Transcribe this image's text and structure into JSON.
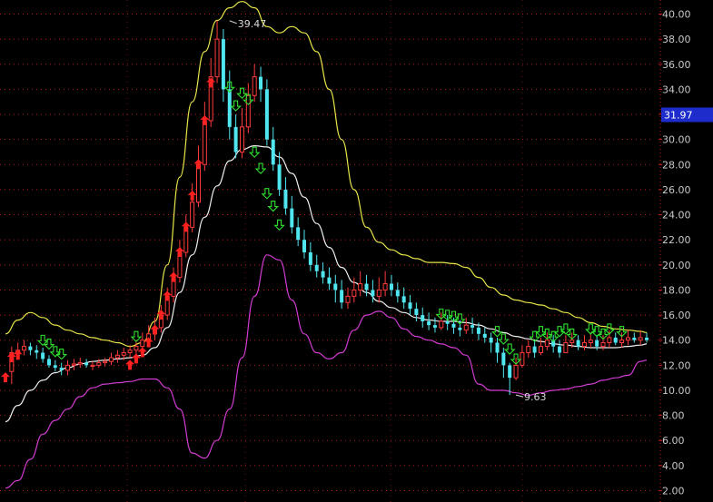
{
  "chart_data": {
    "type": "line",
    "ylim": [
      2,
      41
    ],
    "y_ticks": [
      "2.00",
      "4.00",
      "6.00",
      "8.00",
      "10.00",
      "12.00",
      "14.00",
      "16.00",
      "18.00",
      "20.00",
      "22.00",
      "24.00",
      "26.00",
      "28.00",
      "30.00",
      "32.00",
      "34.00",
      "36.00",
      "38.00",
      "40.00"
    ],
    "current_price_label": "31.97",
    "current_price": 31.97,
    "annotations": [
      {
        "text": "39.47",
        "x": 36,
        "y": 39.47
      },
      {
        "text": "9.63",
        "x": 82,
        "y": 9.63
      }
    ],
    "colors": {
      "upper_band": "#e6e64a",
      "middle_band": "#f0f0f0",
      "lower_band": "#d23cd2",
      "candle_up": "#ff3c3c",
      "candle_down": "#50e6f0",
      "buy_arrow": "#ff2020",
      "sell_arrow": "#30e030",
      "grid": "#c81e1e",
      "price_tag_bg": "#1e2ccc"
    },
    "x_range": [
      0,
      103
    ],
    "series": [
      {
        "key": "upper",
        "x": [
          0,
          2,
          4,
          6,
          8,
          10,
          12,
          14,
          16,
          18,
          20,
          22,
          24,
          26,
          28,
          30,
          32,
          34,
          36,
          38,
          40,
          42,
          44,
          46,
          48,
          50,
          52,
          54,
          56,
          58,
          60,
          62,
          64,
          66,
          68,
          70,
          72,
          74,
          76,
          78,
          80,
          82,
          84,
          86,
          88,
          90,
          92,
          94,
          96,
          98,
          100,
          102,
          103
        ],
        "values": [
          14.5,
          15.6,
          16.2,
          15.8,
          15.2,
          14.8,
          14.5,
          14.2,
          14.0,
          13.8,
          13.5,
          13.8,
          15.5,
          20,
          27,
          33,
          37,
          39.5,
          40.5,
          41,
          40.5,
          39,
          38.5,
          39,
          38.5,
          37,
          34,
          30,
          26,
          23,
          21.8,
          21.2,
          20.8,
          20.5,
          20.2,
          20.2,
          20.1,
          19.8,
          19.0,
          18.2,
          17.6,
          17.2,
          17.0,
          16.8,
          16.5,
          16.2,
          15.8,
          15.4,
          15.1,
          14.9,
          14.8,
          14.7,
          14.6
        ]
      },
      {
        "key": "middle",
        "x": [
          0,
          2,
          4,
          6,
          8,
          10,
          12,
          14,
          16,
          18,
          20,
          22,
          24,
          26,
          28,
          30,
          32,
          34,
          36,
          38,
          40,
          42,
          44,
          46,
          48,
          50,
          52,
          54,
          56,
          58,
          60,
          62,
          64,
          66,
          68,
          70,
          72,
          74,
          76,
          78,
          80,
          82,
          84,
          86,
          88,
          90,
          92,
          94,
          96,
          98,
          100,
          102,
          103
        ],
        "values": [
          7.5,
          8.8,
          10,
          10.8,
          11.4,
          11.8,
          12.1,
          12.3,
          12.4,
          12.5,
          12.6,
          12.8,
          13.4,
          15,
          17.8,
          20.8,
          23.8,
          26.3,
          28.3,
          29.2,
          29.5,
          29.4,
          28.6,
          27.3,
          25.4,
          23.3,
          21.4,
          19.8,
          18.6,
          17.8,
          17.1,
          16.6,
          16.2,
          15.8,
          15.6,
          15.5,
          15.5,
          15.4,
          15.2,
          14.9,
          14.6,
          14.3,
          14.1,
          13.9,
          13.7,
          13.6,
          13.5,
          13.4,
          13.4,
          13.4,
          13.5,
          13.6,
          13.7
        ]
      },
      {
        "key": "lower",
        "x": [
          0,
          2,
          4,
          6,
          8,
          10,
          12,
          14,
          16,
          18,
          20,
          22,
          24,
          26,
          28,
          30,
          32,
          34,
          36,
          38,
          40,
          42,
          44,
          46,
          48,
          50,
          52,
          54,
          56,
          58,
          60,
          62,
          64,
          66,
          68,
          70,
          72,
          74,
          76,
          78,
          80,
          82,
          84,
          86,
          88,
          90,
          92,
          94,
          96,
          98,
          100,
          102,
          103
        ],
        "values": [
          2.2,
          2.8,
          4.5,
          6.5,
          7.6,
          8.5,
          9.5,
          10.2,
          10.5,
          10.6,
          10.7,
          10.9,
          10.9,
          10.2,
          8.5,
          5.0,
          4.6,
          6.0,
          8.5,
          12.6,
          17.5,
          20.8,
          20.4,
          17.2,
          14.5,
          13.0,
          12.5,
          13.0,
          14.8,
          16.0,
          16.3,
          15.8,
          14.9,
          14.3,
          14.0,
          13.7,
          13.4,
          12.8,
          10.5,
          10.0,
          10.0,
          9.8,
          9.6,
          9.8,
          10.0,
          10.1,
          10.3,
          10.5,
          10.8,
          11.0,
          11.2,
          12.3,
          12.4
        ]
      },
      {
        "key": "candles",
        "x": [
          1,
          2,
          3,
          4,
          5,
          6,
          7,
          8,
          9,
          10,
          11,
          12,
          13,
          14,
          15,
          16,
          17,
          18,
          19,
          20,
          21,
          22,
          23,
          24,
          25,
          26,
          27,
          28,
          29,
          30,
          31,
          32,
          33,
          34,
          35,
          36,
          37,
          38,
          39,
          40,
          41,
          42,
          43,
          44,
          45,
          46,
          47,
          48,
          49,
          50,
          51,
          52,
          53,
          54,
          55,
          56,
          57,
          58,
          59,
          60,
          61,
          62,
          63,
          64,
          65,
          66,
          67,
          68,
          69,
          70,
          71,
          72,
          73,
          74,
          75,
          76,
          77,
          78,
          79,
          80,
          81,
          82,
          83,
          84,
          85,
          86,
          87,
          88,
          89,
          90,
          91,
          92,
          93,
          94,
          95,
          96,
          97,
          98,
          99,
          100,
          101,
          102,
          103
        ],
        "open": [
          11.5,
          13.0,
          13.2,
          13.5,
          13.2,
          13.0,
          12.5,
          12.0,
          11.8,
          11.6,
          12.0,
          12.1,
          12.2,
          12.0,
          12.0,
          12.2,
          12.3,
          12.6,
          12.8,
          13.0,
          13.2,
          13.5,
          14.0,
          14.5,
          15.0,
          16.0,
          17.5,
          19.0,
          21.0,
          23.0,
          25.0,
          28.0,
          31.5,
          35.0,
          38.0,
          34.0,
          31.0,
          29.0,
          31.0,
          33.5,
          35.0,
          34.0,
          30.0,
          28.0,
          26.0,
          24.5,
          23.0,
          22.0,
          21.0,
          20.0,
          19.5,
          19.0,
          18.5,
          18.0,
          17.0,
          17.5,
          18.0,
          18.5,
          18.0,
          17.5,
          18.0,
          18.5,
          18.0,
          17.5,
          17.0,
          16.5,
          16.0,
          15.5,
          15.2,
          15.0,
          15.5,
          15.3,
          15.0,
          14.8,
          15.2,
          15.0,
          14.5,
          14.2,
          13.8,
          13.0,
          12.0,
          11.0,
          12.0,
          13.0,
          13.5,
          13.0,
          13.5,
          14.0,
          13.5,
          13.0,
          13.8,
          14.0,
          13.5,
          13.8,
          14.0,
          13.5,
          13.8,
          14.2,
          13.8,
          14.0,
          14.2,
          14.0,
          14.2
        ],
        "close": [
          13.0,
          13.2,
          13.5,
          13.2,
          13.0,
          12.5,
          12.0,
          11.8,
          11.6,
          12.0,
          12.1,
          12.2,
          12.0,
          12.0,
          12.2,
          12.3,
          12.6,
          12.8,
          13.0,
          13.2,
          13.5,
          14.0,
          14.5,
          15.0,
          16.0,
          17.5,
          19.0,
          21.0,
          23.0,
          25.0,
          28.0,
          31.5,
          35.0,
          38.0,
          34.0,
          31.0,
          29.0,
          31.0,
          33.5,
          35.0,
          34.0,
          30.0,
          28.0,
          26.0,
          24.5,
          23.0,
          22.0,
          21.0,
          20.0,
          19.5,
          19.0,
          18.5,
          18.0,
          17.0,
          17.5,
          18.0,
          18.5,
          18.0,
          17.5,
          18.0,
          18.5,
          18.0,
          17.5,
          17.0,
          16.5,
          16.0,
          15.5,
          15.2,
          15.0,
          15.5,
          15.3,
          15.0,
          14.8,
          15.2,
          15.0,
          14.5,
          14.2,
          13.8,
          13.0,
          12.0,
          11.0,
          12.0,
          13.0,
          13.5,
          13.0,
          13.5,
          14.0,
          13.5,
          13.0,
          13.8,
          14.0,
          13.5,
          13.8,
          14.0,
          13.5,
          13.8,
          14.2,
          13.8,
          14.0,
          14.2,
          14.0,
          14.2,
          14.0
        ],
        "high": [
          13.5,
          13.8,
          14.0,
          13.8,
          13.6,
          13.4,
          12.8,
          12.4,
          12.2,
          12.4,
          12.5,
          12.6,
          12.5,
          12.3,
          12.5,
          12.6,
          13.0,
          13.2,
          13.4,
          13.6,
          14.0,
          14.6,
          15.2,
          15.8,
          16.8,
          18.2,
          19.8,
          22.0,
          24.0,
          26.5,
          29.5,
          33.0,
          36.5,
          39.47,
          38.8,
          35.5,
          32.0,
          32.5,
          34.5,
          36.0,
          35.8,
          34.8,
          31.0,
          29.0,
          27.0,
          25.5,
          23.8,
          22.8,
          21.8,
          20.8,
          20.2,
          19.8,
          19.2,
          18.8,
          18.2,
          19.0,
          19.5,
          19.2,
          18.8,
          19.0,
          19.5,
          19.2,
          18.6,
          18.2,
          17.6,
          17.0,
          16.6,
          16.2,
          15.8,
          16.2,
          16.0,
          15.8,
          15.6,
          15.8,
          15.8,
          15.4,
          15.0,
          14.6,
          14.2,
          13.4,
          12.2,
          12.6,
          13.6,
          14.0,
          14.0,
          14.2,
          14.6,
          14.4,
          14.0,
          14.4,
          14.6,
          14.4,
          14.4,
          14.6,
          14.4,
          14.4,
          14.8,
          14.6,
          14.6,
          14.8,
          14.6,
          14.8,
          14.6
        ],
        "low": [
          10.5,
          12.5,
          12.8,
          12.8,
          12.5,
          12.2,
          11.8,
          11.5,
          11.2,
          11.2,
          11.6,
          11.8,
          11.8,
          11.6,
          11.8,
          11.9,
          12.0,
          12.2,
          12.4,
          12.6,
          12.8,
          13.0,
          13.6,
          14.0,
          14.6,
          15.6,
          17.0,
          18.6,
          20.6,
          22.6,
          24.6,
          27.5,
          31.0,
          34.5,
          33.0,
          30.0,
          28.5,
          28.5,
          30.5,
          33.0,
          33.0,
          29.5,
          27.5,
          25.5,
          24.0,
          22.5,
          21.5,
          20.5,
          19.5,
          19.0,
          18.5,
          18.0,
          17.0,
          16.5,
          16.5,
          17.0,
          17.5,
          17.5,
          17.0,
          17.0,
          17.5,
          17.5,
          17.0,
          16.5,
          16.0,
          15.5,
          15.0,
          14.8,
          14.6,
          14.8,
          14.8,
          14.5,
          14.3,
          14.5,
          14.5,
          14.0,
          13.8,
          13.0,
          12.2,
          11.0,
          9.63,
          10.8,
          11.8,
          12.6,
          12.6,
          12.8,
          13.2,
          13.0,
          12.6,
          13.0,
          13.4,
          13.2,
          13.2,
          13.4,
          13.2,
          13.2,
          13.4,
          13.6,
          13.4,
          13.6,
          13.8,
          13.6,
          13.8
        ]
      },
      {
        "key": "buy_arrows",
        "x": [
          0,
          1,
          2,
          20,
          21,
          22,
          23,
          24,
          25,
          26,
          27,
          28,
          29,
          30,
          31,
          32,
          33
        ],
        "values": [
          11.0,
          12.6,
          12.8,
          12.0,
          12.5,
          13.0,
          13.8,
          14.8,
          16.0,
          17.5,
          19.0,
          21.0,
          23.0,
          25.5,
          28.0,
          31.5,
          34.5
        ]
      },
      {
        "key": "sell_arrows",
        "x": [
          6,
          7,
          8,
          9,
          21,
          36,
          37,
          38,
          39,
          40,
          41,
          42,
          43,
          44,
          70,
          71,
          72,
          73,
          79,
          80,
          81,
          82,
          85,
          86,
          87,
          88,
          89,
          90,
          91,
          94,
          95,
          96,
          97,
          99
        ],
        "values": [
          13.3,
          13.0,
          12.4,
          12.2,
          13.6,
          33.5,
          32.0,
          33.0,
          32.5,
          28.3,
          27.0,
          25.0,
          24.0,
          22.5,
          15.4,
          15.3,
          15.2,
          15.0,
          14.0,
          13.4,
          12.6,
          11.8,
          13.6,
          14.0,
          13.8,
          13.6,
          14.0,
          14.2,
          13.8,
          14.2,
          14.0,
          13.8,
          14.2,
          14.0
        ]
      }
    ]
  }
}
